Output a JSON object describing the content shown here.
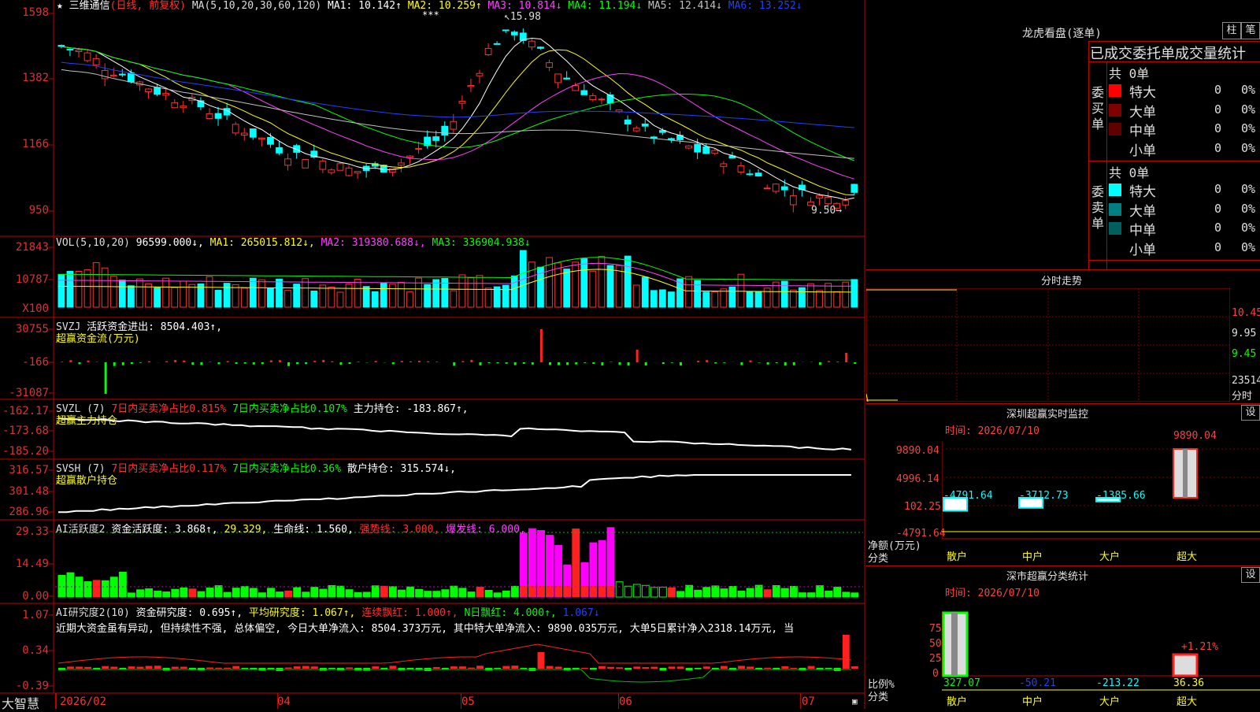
{
  "app": {
    "brand": "大智慧"
  },
  "main_chart": {
    "stock_name": "三维通信",
    "period_note": "(日线, 前复权)",
    "ma_params": "MA(5,10,20,30,60,120)",
    "ma_values": [
      {
        "label": "MA1: 10.142↑",
        "color": "#ffffff"
      },
      {
        "label": "MA2: 10.259↑",
        "color": "#ffff00"
      },
      {
        "label": "MA3: 10.814↓",
        "color": "#ff40ff"
      },
      {
        "label": "MA4: 11.194↓",
        "color": "#00ff00"
      },
      {
        "label": "MA5: 12.414↓",
        "color": "#c0c0c0"
      },
      {
        "label": "MA6: 13.252↓",
        "color": "#2040ff"
      }
    ],
    "high_mark": "15.98",
    "low_mark": "9.50→",
    "y_ticks": [
      "1598",
      "1382",
      "1166",
      "950"
    ]
  },
  "vol_panel": {
    "title": "VOL(5,10,20)",
    "value": "96599.000↓,",
    "ma1": "MA1: 265015.812↓,",
    "ma2": "MA2: 319380.688↓,",
    "ma3": "MA3: 336904.938↓",
    "y_ticks": [
      "21843",
      "10787",
      "X100"
    ]
  },
  "svzj_panel": {
    "title": "SVZJ",
    "line1": "活跃资金进出: 8504.403↑,",
    "line2": "超赢资金流(万元)",
    "y_ticks": [
      "30755",
      "-166",
      "-31087"
    ]
  },
  "svzl_panel": {
    "title": "SVZL (7)",
    "a": "7日内买卖净占比0.815%",
    "b": "7日内买卖净占比0.107%",
    "c": "主力持仓: -183.867↑,",
    "line2": "超赢主力持仓",
    "y_ticks": [
      "-162.17",
      "-173.68",
      "-185.20"
    ]
  },
  "svsh_panel": {
    "title": "SVSH (7)",
    "a": "7日内买卖净占比0.117%",
    "b": "7日内买卖净占比0.36%",
    "c": "散户持仓: 315.574↓,",
    "line2": "超赢散户持仓",
    "y_ticks": [
      "316.57",
      "301.48",
      "286.96"
    ]
  },
  "ai2_panel": {
    "title": "AI活跃度2",
    "a": "资金活跃度: 3.868↑,",
    "b": "29.329,",
    "c": "生命线: 1.560,",
    "d": "强势线: 3.000,",
    "e": "爆发线: 6.000,",
    "y_ticks": [
      "29.33",
      "14.49",
      "0.00"
    ]
  },
  "ai_research_panel": {
    "title": "AI研究度2(10)",
    "a": "资金研究度: 0.695↑,",
    "b": "平均研究度: 1.067↑,",
    "c": "连续飘红: 1.000↑,",
    "d": "N日飘红: 4.000↑,",
    "e": "1.067↓",
    "comment": "近期大资金虽有异动, 但持续性不强, 总体偏空, 今日大单净流入: 8504.373万元, 其中特大单净流入: 9890.035万元, 大单5日累计净入2318.14万元, 当",
    "y_ticks": [
      "1.07",
      "0.34",
      "-0.39"
    ]
  },
  "x_axis": {
    "labels": [
      "2026/02",
      "04",
      "05",
      "06",
      "07"
    ]
  },
  "right_panel": {
    "title": "龙虎看盘(逐单)",
    "btn_bar": "柱",
    "btn_pen": "笔",
    "header": "已成交委托单成交量统计",
    "buy_side_label": "委买单",
    "sell_side_label": "委卖单",
    "buy_total": "共 0单",
    "sell_total": "共 0单",
    "buy_rows": [
      {
        "name": "特大",
        "count": "0",
        "pct": "0%",
        "color": "#ff0000"
      },
      {
        "name": "大单",
        "count": "0",
        "pct": "0%",
        "color": "#800000"
      },
      {
        "name": "中单",
        "count": "0",
        "pct": "0%",
        "color": "#600000"
      },
      {
        "name": "小单",
        "count": "0",
        "pct": "0%",
        "color": "#000000"
      }
    ],
    "sell_rows": [
      {
        "name": "特大",
        "count": "0",
        "pct": "0%",
        "color": "#00ffff"
      },
      {
        "name": "大单",
        "count": "0",
        "pct": "0%",
        "color": "#008080"
      },
      {
        "name": "中单",
        "count": "0",
        "pct": "0%",
        "color": "#006060"
      },
      {
        "name": "小单",
        "count": "0",
        "pct": "0%",
        "color": "#000000"
      }
    ],
    "intraday_title": "分时走势",
    "intraday_y": [
      "10.45",
      "9.95",
      "9.45",
      "23514",
      "分时"
    ],
    "monitor_title": "深圳超赢实时监控",
    "monitor_btn": "设",
    "monitor_time": "时间: 2026/07/10",
    "monitor_y": [
      "9890.04",
      "4996.14",
      "102.25",
      "-4791.64"
    ],
    "monitor_unit1": "净额(万元)",
    "monitor_unit2": "分类",
    "monitor_bars": [
      {
        "cat": "散户",
        "value": "-4791.64"
      },
      {
        "cat": "中户",
        "value": "-3712.73"
      },
      {
        "cat": "大户",
        "value": "-1385.66"
      },
      {
        "cat": "超大",
        "value": "9890.04"
      }
    ],
    "class_title": "深市超赢分类统计",
    "class_btn": "设",
    "class_time": "时间: 2026/07/10",
    "class_y": [
      "75",
      "50",
      "25",
      "0"
    ],
    "class_unit1": "比例%",
    "class_unit2": "分类",
    "class_extra": "+1.21%",
    "class_bars": [
      {
        "cat": "散户",
        "value": "327.07"
      },
      {
        "cat": "中户",
        "value": "-50.21"
      },
      {
        "cat": "大户",
        "value": "-213.22"
      },
      {
        "cat": "超大",
        "value": "36.36"
      }
    ]
  },
  "chart_data": {
    "type": "candlestick",
    "title": "三维通信",
    "ylim": [
      9.5,
      15.98
    ],
    "series_note": "daily candles 2026/02 - 2026/07",
    "close_approx": [
      14.9,
      14.7,
      14.2,
      13.9,
      13.5,
      13.2,
      13.0,
      12.6,
      12.2,
      11.8,
      11.4,
      11.3,
      11.0,
      10.8,
      10.9,
      11.1,
      11.6,
      12.0,
      13.5,
      15.0,
      15.4,
      14.8,
      14.0,
      13.5,
      13.0,
      12.5,
      12.0,
      11.8,
      11.5,
      11.3,
      11.0,
      10.5,
      10.2,
      10.0,
      9.9,
      10.1
    ]
  }
}
